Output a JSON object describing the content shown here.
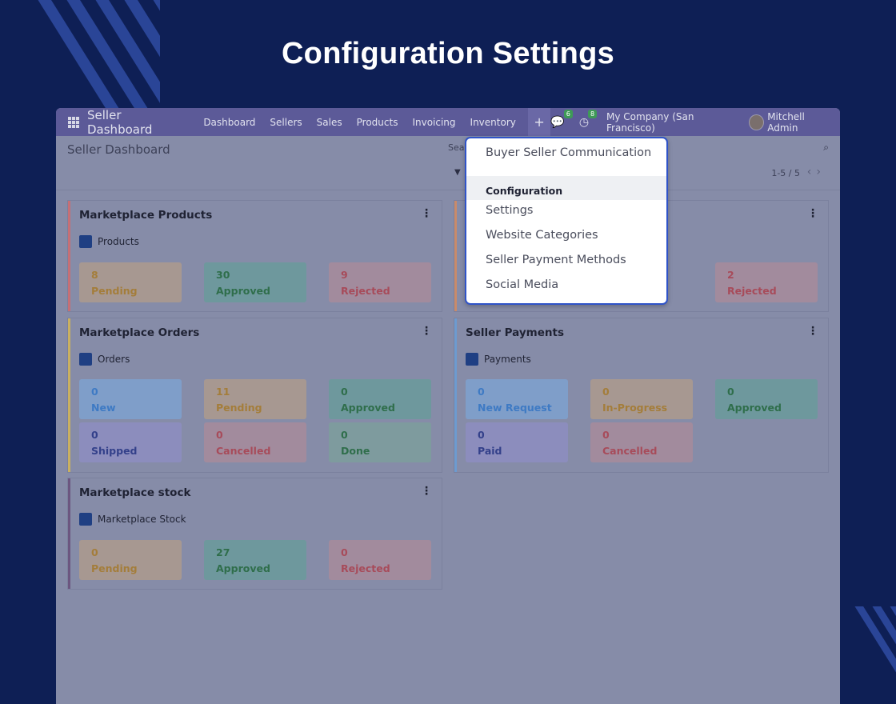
{
  "hero": {
    "title": "Configuration Settings"
  },
  "nav": {
    "brand": "Seller Dashboard",
    "menu": [
      "Dashboard",
      "Sellers",
      "Sales",
      "Products",
      "Invoicing",
      "Inventory"
    ],
    "plus": "+",
    "messages_count": "6",
    "activities_count": "8",
    "company": "My Company (San Francisco)",
    "user": "Mitchell Admin"
  },
  "control_panel": {
    "breadcrumb": "Seller Dashboard",
    "search_text": "Sea",
    "pager": "1-5 / 5",
    "prev": "‹",
    "next": "›"
  },
  "cards": {
    "products": {
      "title": "Marketplace Products",
      "sub": "Products",
      "tiles": [
        {
          "count": "8",
          "label": "Pending"
        },
        {
          "count": "30",
          "label": "Approved"
        },
        {
          "count": "9",
          "label": "Rejected"
        }
      ]
    },
    "sellers": {
      "tile_rejected": {
        "count": "2",
        "label": "Rejected"
      }
    },
    "orders": {
      "title": "Marketplace Orders",
      "sub": "Orders",
      "tiles": [
        {
          "count": "0",
          "label": "New"
        },
        {
          "count": "11",
          "label": "Pending"
        },
        {
          "count": "0",
          "label": "Approved"
        },
        {
          "count": "0",
          "label": "Shipped"
        },
        {
          "count": "0",
          "label": "Cancelled"
        },
        {
          "count": "0",
          "label": "Done"
        }
      ]
    },
    "payments": {
      "title": "Seller Payments",
      "sub": "Payments",
      "tiles": [
        {
          "count": "0",
          "label": "New Request"
        },
        {
          "count": "0",
          "label": "In-Progress"
        },
        {
          "count": "0",
          "label": "Approved"
        },
        {
          "count": "0",
          "label": "Paid"
        },
        {
          "count": "0",
          "label": "Cancelled"
        }
      ]
    },
    "stock": {
      "title": "Marketplace stock",
      "sub": "Marketplace Stock",
      "tiles": [
        {
          "count": "0",
          "label": "Pending"
        },
        {
          "count": "27",
          "label": "Approved"
        },
        {
          "count": "0",
          "label": "Rejected"
        }
      ]
    }
  },
  "dropdown": {
    "item_top": "Buyer Seller Communication",
    "header": "Configuration",
    "items": [
      "Settings",
      "Website Categories",
      "Seller Payment Methods",
      "Social Media"
    ]
  },
  "colors": {
    "primary": "#0e1f55",
    "accent": "#2f53c8",
    "navbar": "#5c5a98"
  }
}
